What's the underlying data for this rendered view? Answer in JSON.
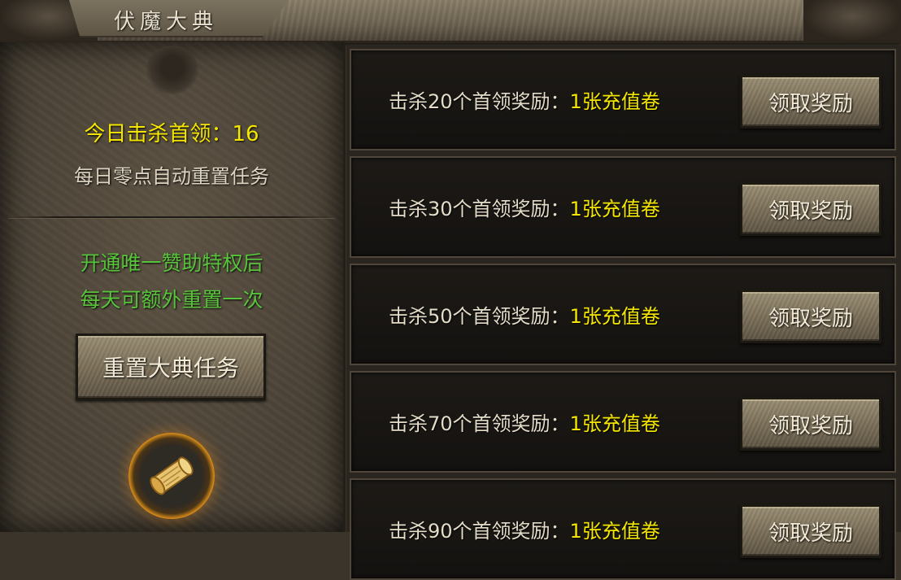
{
  "header": {
    "title": "伏魔大典"
  },
  "left": {
    "kills_label": "今日击杀首领：",
    "kills_value": "16",
    "reset_info": "每日零点自动重置任务",
    "privilege_line1": "开通唯一赞助特权后",
    "privilege_line2": "每天可额外重置一次",
    "reset_button": "重置大典任务",
    "scroll_icon": "scroll-icon"
  },
  "tasks": [
    {
      "prefix": "击杀20个首领奖励：",
      "reward": "1张充值卷",
      "button": "领取奖励"
    },
    {
      "prefix": "击杀30个首领奖励：",
      "reward": "1张充值卷",
      "button": "领取奖励"
    },
    {
      "prefix": "击杀50个首领奖励：",
      "reward": "1张充值卷",
      "button": "领取奖励"
    },
    {
      "prefix": "击杀70个首领奖励：",
      "reward": "1张充值卷",
      "button": "领取奖励"
    },
    {
      "prefix": "击杀90个首领奖励：",
      "reward": "1张充值卷",
      "button": "领取奖励"
    }
  ],
  "colors": {
    "highlight": "#f5e600",
    "privilege": "#58c43c",
    "text": "#e4dcc8"
  }
}
